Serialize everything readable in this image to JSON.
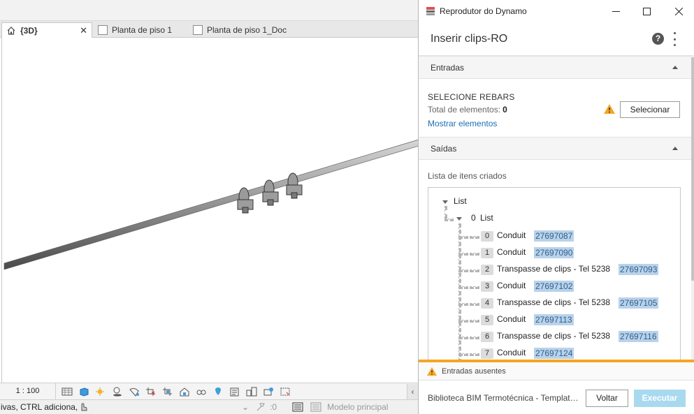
{
  "revit": {
    "view_tabs": [
      {
        "label": "{3D}",
        "icon": "house-icon",
        "active": true
      },
      {
        "label": "Planta de piso 1",
        "icon": "sheet-icon",
        "active": false
      },
      {
        "label": "Planta de piso 1_Doc",
        "icon": "sheet-icon",
        "active": false
      }
    ],
    "view_bar": {
      "scale": "1 : 100",
      "icons": [
        "detail-level-icon",
        "visual-style-icon",
        "sun-path-icon",
        "shadows-icon",
        "render-icon",
        "crop-view-icon",
        "show-crop-icon",
        "unlock-3d-icon",
        "temporary-hide-icon",
        "reveal-hidden-icon",
        "temporary-view-properties-icon",
        "worksharing-icon",
        "analytical-model-icon",
        "highlight-displacement-icon"
      ]
    },
    "status_bar": {
      "text": "ivas, CTRL adiciona, S",
      "filter_count": ":0",
      "model": "Modelo principal"
    }
  },
  "player": {
    "window_title": "Reprodutor do Dynamo",
    "script_name": "Inserir clips-RO",
    "inputs_section": "Entradas",
    "input": {
      "title": "SELECIONE REBARS",
      "count_label": "Total de elementos:",
      "count_value": "0",
      "show_link": "Mostrar elementos",
      "select_button": "Selecionar"
    },
    "outputs_section": "Saídas",
    "output_list_label": "Lista de itens criados",
    "tree": {
      "root_label": "List",
      "sub_index": "0",
      "sub_label": "List",
      "items": [
        {
          "index": "0",
          "name": "Conduit",
          "id": "27697087"
        },
        {
          "index": "1",
          "name": "Conduit",
          "id": "27697090"
        },
        {
          "index": "2",
          "name": "Transpasse de clips - Tel 5238",
          "id": "27697093"
        },
        {
          "index": "3",
          "name": "Conduit",
          "id": "27697102"
        },
        {
          "index": "4",
          "name": "Transpasse de clips - Tel 5238",
          "id": "27697105"
        },
        {
          "index": "5",
          "name": "Conduit",
          "id": "27697113"
        },
        {
          "index": "6",
          "name": "Transpasse de clips - Tel 5238",
          "id": "27697116"
        },
        {
          "index": "7",
          "name": "Conduit",
          "id": "27697124"
        }
      ]
    },
    "warning_text": "Entradas ausentes",
    "library_name": "Biblioteca BIM Termotécnica - Template Elétrica",
    "back_button": "Voltar",
    "run_button": "Executar",
    "colors": {
      "accent_warning": "#f5a623",
      "run_disabled": "#a9d9ef",
      "link": "#1b6fb5",
      "id_highlight": "#b9d2ea"
    }
  }
}
